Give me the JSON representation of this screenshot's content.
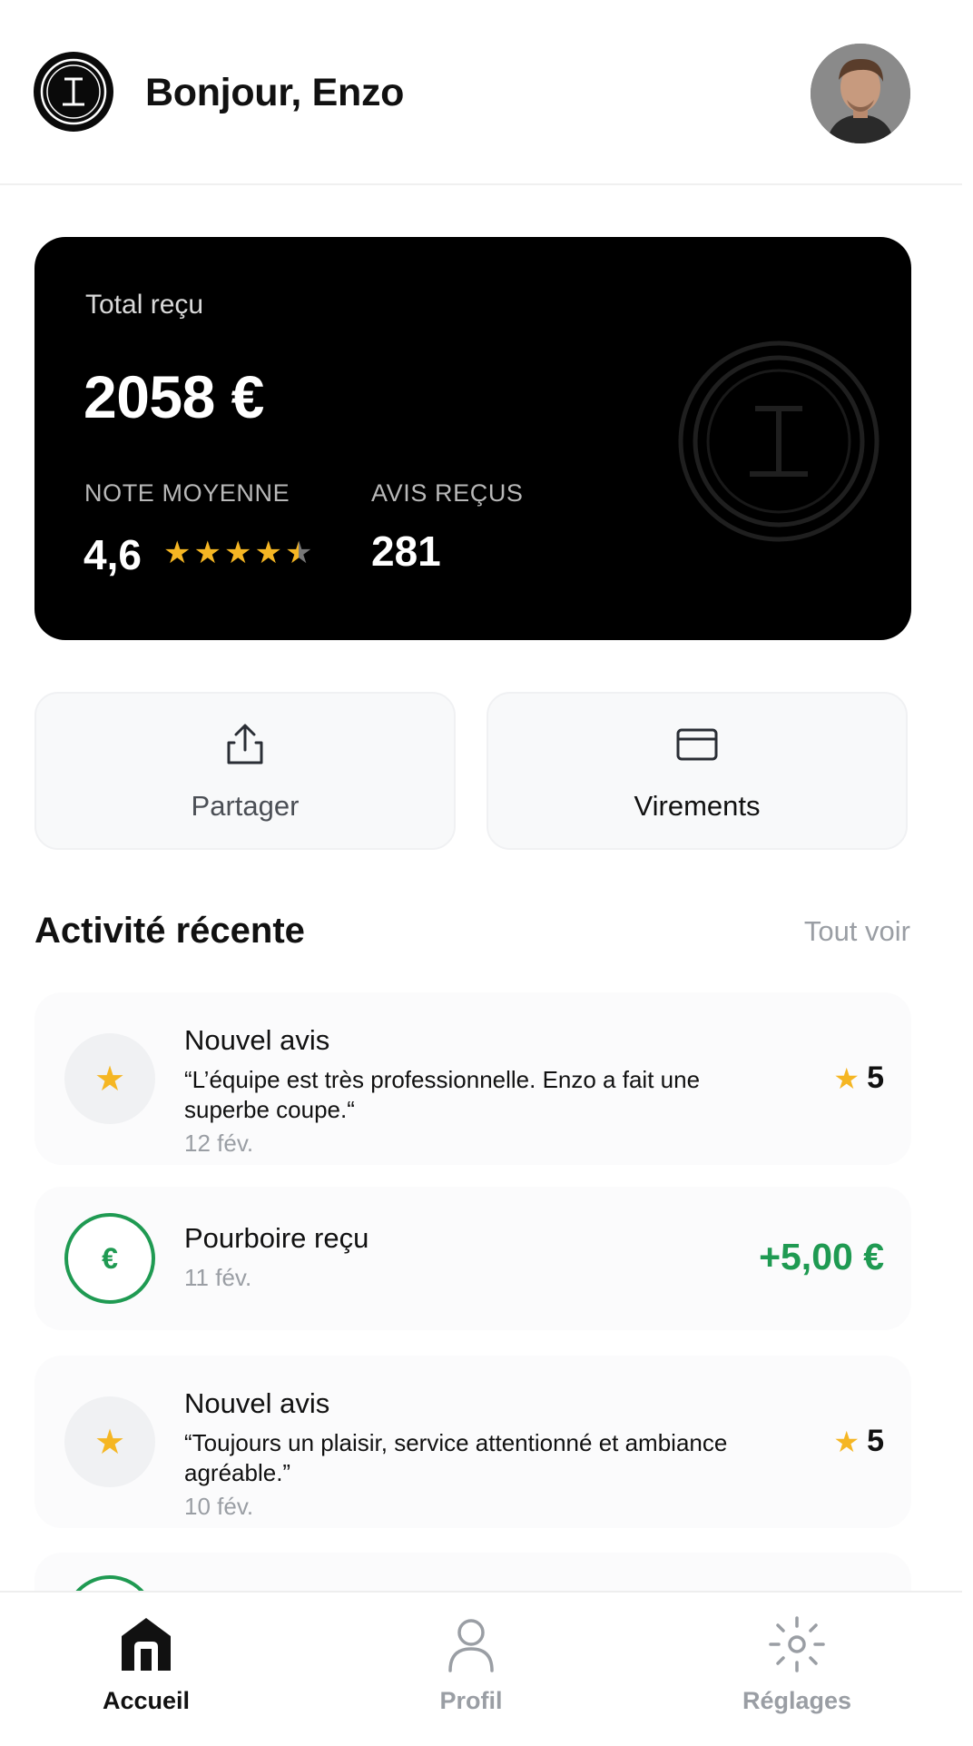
{
  "header": {
    "greeting": "Bonjour, Enzo",
    "logo_icon": "brand-logo-icon",
    "avatar_icon": "user-avatar"
  },
  "summary": {
    "total_label": "Total reçu",
    "total_value": "2058 €",
    "rating_label": "NOTE MOYENNE",
    "rating_value": "4,6",
    "rating_stars": 4.6,
    "reviews_label": "AVIS REÇUS",
    "reviews_value": "281"
  },
  "actions": {
    "share_label": "Partager",
    "share_icon": "share-icon",
    "transfer_label": "Virements",
    "transfer_icon": "card-icon"
  },
  "activity": {
    "title": "Activité récente",
    "see_all": "Tout voir",
    "items": [
      {
        "type": "review",
        "title": "Nouvel avis",
        "quote": "“L’équipe est très professionnelle. Enzo a fait une superbe coupe.“",
        "date": "12 fév.",
        "score": "5"
      },
      {
        "type": "tip",
        "title": "Pourboire reçu",
        "date": "11 fév.",
        "amount": "+5,00 €",
        "currency_symbol": "€"
      },
      {
        "type": "review",
        "title": "Nouvel avis",
        "quote": "“Toujours un plaisir, service attentionné et ambiance agréable.”",
        "date": "10 fév.",
        "score": "5"
      }
    ]
  },
  "nav": {
    "home_label": "Accueil",
    "profile_label": "Profil",
    "settings_label": "Réglages"
  },
  "colors": {
    "accent_star": "#f5b623",
    "positive": "#1f9a52",
    "card_bg": "#000000",
    "muted_text": "#9a9ea4"
  }
}
